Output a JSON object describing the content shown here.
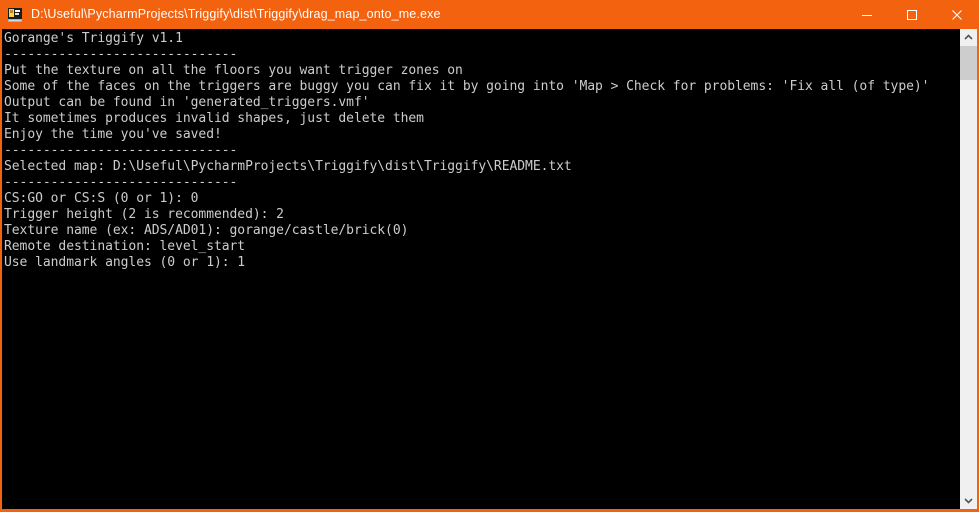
{
  "window": {
    "title": "D:\\Useful\\PycharmProjects\\Triggify\\dist\\Triggify\\drag_map_onto_me.exe",
    "icon": "console-app-icon",
    "accent_color": "#f2620f",
    "title_text_color": "#ffffff",
    "console_bg": "#000000",
    "console_fg": "#cccccc",
    "controls": {
      "minimize_label": "Minimize",
      "maximize_label": "Maximize",
      "close_label": "Close"
    }
  },
  "console": {
    "lines": [
      "Gorange's Triggify v1.1",
      "------------------------------",
      "Put the texture on all the floors you want trigger zones on",
      "Some of the faces on the triggers are buggy you can fix it by going into 'Map > Check for problems: 'Fix all (of type)'",
      "Output can be found in 'generated_triggers.vmf'",
      "It sometimes produces invalid shapes, just delete them",
      "Enjoy the time you've saved!",
      "------------------------------",
      "Selected map: D:\\Useful\\PycharmProjects\\Triggify\\dist\\Triggify\\README.txt",
      "------------------------------",
      "CS:GO or CS:S (0 or 1): 0",
      "Trigger height (2 is recommended): 2",
      "Texture name (ex: ADS/AD01): gorange/castle/brick(0)",
      "Remote destination: level_start",
      "Use landmark angles (0 or 1): 1"
    ]
  },
  "scrollbar": {
    "up_icon": "chevron-up-icon",
    "down_icon": "chevron-down-icon",
    "thumb_name": "scrollbar-thumb"
  }
}
